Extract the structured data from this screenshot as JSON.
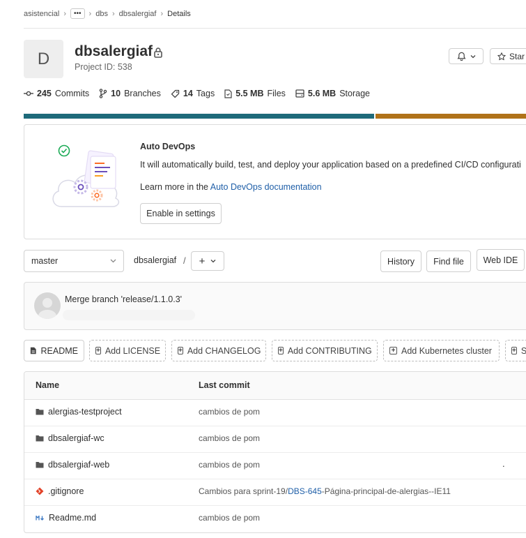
{
  "breadcrumb": {
    "items": [
      "asistencial",
      "dbs",
      "dbsalergiaf"
    ],
    "ellipsis": "•••",
    "current": "Details"
  },
  "project": {
    "avatar_letter": "D",
    "name": "dbsalergiaf",
    "id_label": "Project ID: 538",
    "star_label": "Star"
  },
  "stats": [
    {
      "value": "245",
      "label": "Commits",
      "icon": "commit-icon"
    },
    {
      "value": "10",
      "label": "Branches",
      "icon": "branch-icon"
    },
    {
      "value": "14",
      "label": "Tags",
      "icon": "tag-icon"
    },
    {
      "value": "5.5 MB",
      "label": "Files",
      "icon": "file-icon"
    },
    {
      "value": "5.6 MB",
      "label": "Storage",
      "icon": "storage-icon"
    }
  ],
  "language_bar": {
    "segments": [
      {
        "color": "#1e6a7a",
        "share": 0.6912
      },
      {
        "color": "#b07219",
        "share": 0.3088
      }
    ]
  },
  "auto_devops": {
    "title": "Auto DevOps",
    "description": "It will automatically build, test, and deploy your application based on a predefined CI/CD configurati",
    "learn_prefix": "Learn more in the ",
    "learn_link": "Auto DevOps documentation",
    "enable_label": "Enable in settings"
  },
  "toolbar": {
    "branch": "master",
    "path": "dbsalergiaf",
    "path_sep": "/",
    "add_label": "+",
    "history": "History",
    "find_file": "Find file",
    "web_ide": "Web IDE"
  },
  "last_commit": {
    "message": "Merge branch 'release/1.1.0.3'"
  },
  "doc_buttons": {
    "readme": "README",
    "add_license": "Add LICENSE",
    "add_changelog": "Add CHANGELOG",
    "add_contributing": "Add CONTRIBUTING",
    "add_kubernetes": "Add Kubernetes cluster",
    "next_partial": "S"
  },
  "files": {
    "headers": {
      "name": "Name",
      "last_commit": "Last commit"
    },
    "rows": [
      {
        "name": "alergias-testproject",
        "type": "folder",
        "commit": "cambios de pom"
      },
      {
        "name": "dbsalergiaf-wc",
        "type": "folder",
        "commit": "cambios de pom"
      },
      {
        "name": "dbsalergiaf-web",
        "type": "folder",
        "commit": "cambios de pom"
      },
      {
        "name": ".gitignore",
        "type": "git",
        "commit_prefix": "Cambios para sprint-19/",
        "commit_link": "DBS-645",
        "commit_suffix": "-Página-principal-de-alergias--IE11"
      },
      {
        "name": "Readme.md",
        "type": "markdown",
        "commit": "cambios de pom"
      }
    ],
    "stray_dot": "."
  }
}
